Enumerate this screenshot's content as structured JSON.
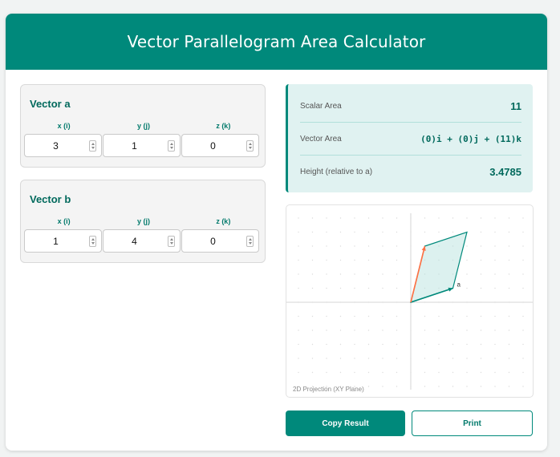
{
  "app": {
    "title": "Vector Parallelogram Area Calculator",
    "accent": "#00897b"
  },
  "vector_a": {
    "title": "Vector a",
    "components": [
      {
        "label": "x (i)",
        "value": "3"
      },
      {
        "label": "y (j)",
        "value": "1"
      },
      {
        "label": "z (k)",
        "value": "0"
      }
    ]
  },
  "vector_b": {
    "title": "Vector b",
    "components": [
      {
        "label": "x (i)",
        "value": "1"
      },
      {
        "label": "y (j)",
        "value": "4"
      },
      {
        "label": "z (k)",
        "value": "0"
      }
    ]
  },
  "results": {
    "scalar_area": {
      "label": "Scalar Area",
      "value": "11"
    },
    "vector_area": {
      "label": "Vector Area",
      "value": "(0)i + (0)j + (11)k"
    },
    "height": {
      "label": "Height (relative to a)",
      "value": "3.4785"
    }
  },
  "projection": {
    "caption": "2D Projection (XY Plane)",
    "label_a": "a",
    "a": [
      3,
      1
    ],
    "b": [
      1,
      4
    ],
    "colors": {
      "a": "#00897b",
      "b": "#ff7043",
      "fill": "#b2dfdb"
    }
  },
  "actions": {
    "copy_label": "Copy Result",
    "print_label": "Print"
  }
}
